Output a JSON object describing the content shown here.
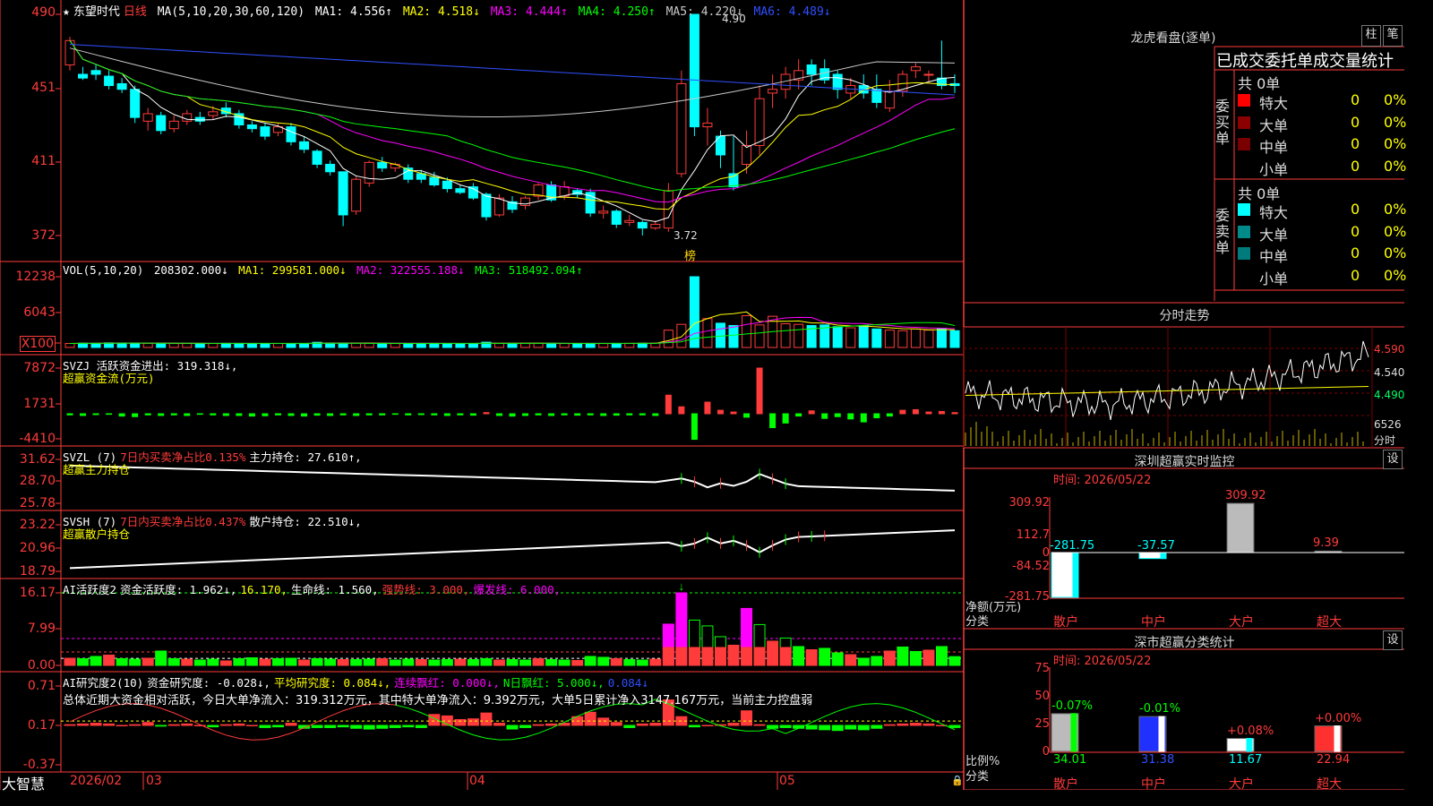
{
  "stock": {
    "star": "★",
    "name": "东望时代",
    "period": "日线"
  },
  "main_chart": {
    "ma_header": [
      "MA(5,10,20,30,60,120)",
      "MA1: 4.556↑",
      "MA2: 4.518↓",
      "MA3: 4.444↑",
      "MA4: 4.250↑",
      "MA5: 4.220↓",
      "MA6: 4.489↓"
    ],
    "y_labels": [
      "490",
      "451",
      "411",
      "372"
    ],
    "high_label": "4.90",
    "low_label": "3.72",
    "bang_label": "榜"
  },
  "vol_chart": {
    "header": [
      "VOL(5,10,20)",
      "208302.000↓",
      "MA1: 299581.000↓",
      "MA2: 322555.188↓",
      "MA3: 518492.094↑"
    ],
    "y_labels": [
      "12238",
      "6043",
      "X100"
    ]
  },
  "svzj": {
    "header1": "SVZJ  活跃资金进出: 319.318↓,",
    "header2": "超赢资金流(万元)",
    "y_labels": [
      "7872",
      "1731",
      "-4410"
    ]
  },
  "svzl": {
    "header_a": "SVZL (7)",
    "header_b": "7日内买卖净占比0.135%",
    "header_c": "主力持仓: 27.610↑,",
    "header2": "超赢主力持仓",
    "y_labels": [
      "31.62",
      "28.70",
      "25.78"
    ]
  },
  "svsh": {
    "header_a": "SVSH (7)",
    "header_b": "7日内买卖净占比0.437%",
    "header_c": "散户持仓: 22.510↓,",
    "header2": "超赢散户持仓",
    "y_labels": [
      "23.22",
      "20.96",
      "18.79"
    ]
  },
  "ai1": {
    "header_a": "AI活跃度2",
    "header_b": "资金活跃度: 1.962↓,",
    "header_c": "16.170,",
    "header_d": "生命线: 1.560,",
    "header_e": "强势线: 3.000,",
    "header_f": "爆发线: 6.000,",
    "y_labels": [
      "16.17",
      "7.99",
      "0.00"
    ]
  },
  "ai2": {
    "header_a": "AI研究度2(10)",
    "header_b": "资金研究度: -0.028↓,",
    "header_c": "平均研究度: 0.084↓,",
    "header_d": "连续飘红: 0.000↓,",
    "header_e": "N日飘红: 5.000↓,",
    "header_f": "0.084↓",
    "desc": "总体近期大资金相对活跃，今日大单净流入：319.312万元，其中特大单净流入：9.392万元，大单5日累计净入3147.167万元，当前主力控盘弱",
    "y_labels": [
      "0.71",
      "0.17",
      "-0.37"
    ]
  },
  "x_axis": {
    "logo": "大智慧",
    "labels": [
      "2026/02",
      "03",
      "04",
      "05"
    ]
  },
  "right": {
    "dragon_title": "龙虎看盘(逐单)",
    "btn1": "柱",
    "btn2": "笔",
    "stat_title": "已成交委托单成交量统计",
    "buy_side": {
      "label": "委买单",
      "total": "共 0单",
      "rows": [
        {
          "name": "特大",
          "v": "0",
          "p": "0%",
          "color": "#ff0000"
        },
        {
          "name": "大单",
          "v": "0",
          "p": "0%",
          "color": "#8b0000"
        },
        {
          "name": "中单",
          "v": "0",
          "p": "0%",
          "color": "#7a0000"
        },
        {
          "name": "小单",
          "v": "0",
          "p": "0%",
          "color": ""
        }
      ]
    },
    "sell_side": {
      "label": "委卖单",
      "total": "共 0单",
      "rows": [
        {
          "name": "特大",
          "v": "0",
          "p": "0%",
          "color": "#00ffff"
        },
        {
          "name": "大单",
          "v": "0",
          "p": "0%",
          "color": "#008b8b"
        },
        {
          "name": "中单",
          "v": "0",
          "p": "0%",
          "color": "#007a7a"
        },
        {
          "name": "小单",
          "v": "0",
          "p": "0%",
          "color": ""
        }
      ]
    },
    "fenshi_title": "分时走势",
    "fenshi_labels": [
      "4.590",
      "4.540",
      "4.490",
      "6526",
      "分时"
    ],
    "monitor": {
      "title": "深圳超赢实时监控",
      "btn": "设",
      "time": "时间: 2026/05/22",
      "y_labels": [
        "309.92",
        "112.7",
        "0",
        "-84.52",
        "-281.75"
      ],
      "unit": "净额(万元)",
      "cat": "分类",
      "cats": [
        "散户",
        "中户",
        "大户",
        "超大"
      ],
      "values": [
        "-281.75",
        "-37.57",
        "309.92",
        "9.39"
      ]
    },
    "classify": {
      "title": "深市超赢分类统计",
      "btn": "设",
      "time": "时间: 2026/05/22",
      "y_labels": [
        "75",
        "50",
        "25",
        "0"
      ],
      "unit": "比例%",
      "cat": "分类",
      "cats": [
        "散户",
        "中户",
        "大户",
        "超大"
      ],
      "pct": [
        "34.01",
        "31.38",
        "11.67",
        "22.94"
      ],
      "delta": [
        "-0.07%",
        "-0.01%",
        "+0.08%",
        "+0.00%"
      ]
    }
  },
  "colors": {
    "red": "#ff3b3b",
    "cyan": "#00ffff",
    "yellow": "#ffff00",
    "magenta": "#ff00ff",
    "green": "#00ff00",
    "white": "#ffffff"
  }
}
